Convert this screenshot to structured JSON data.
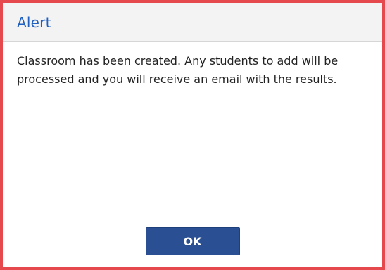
{
  "dialog": {
    "title": "Alert",
    "message": "Classroom has been created. Any students to add will be processed and you will receive an email with the results.",
    "ok_label": "OK"
  },
  "colors": {
    "border_accent": "#e5484d",
    "title_text": "#1f5fbf",
    "titlebar_bg": "#f3f3f3",
    "button_bg": "#2b4f93"
  }
}
